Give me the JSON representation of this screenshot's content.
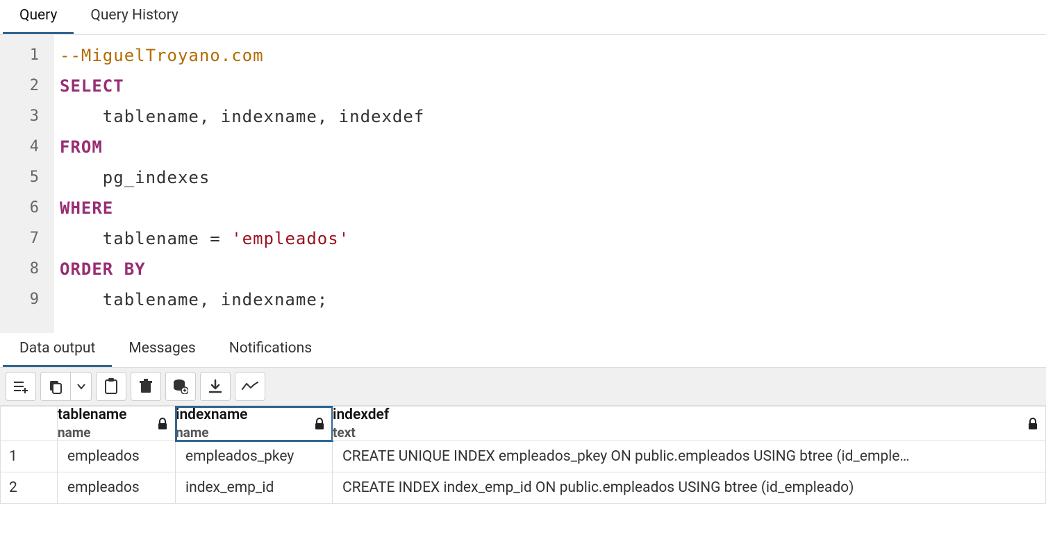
{
  "tabs": {
    "query": "Query",
    "history": "Query History"
  },
  "editor": {
    "lines": [
      "1",
      "2",
      "3",
      "4",
      "5",
      "6",
      "7",
      "8",
      "9"
    ],
    "code": {
      "l1": "--MiguelTroyano.com",
      "l2": "SELECT",
      "l3": "    tablename, indexname, indexdef",
      "l4": "FROM",
      "l5": "    pg_indexes",
      "l6": "WHERE",
      "l7a": "    tablename ",
      "l7op": "=",
      "l7b": " ",
      "l7str": "'empleados'",
      "l8": "ORDER BY",
      "l9": "    tablename, indexname;"
    }
  },
  "output_tabs": {
    "data": "Data output",
    "messages": "Messages",
    "notifications": "Notifications"
  },
  "toolbar_icons": {
    "add_row": "add-row-icon",
    "copy": "copy-icon",
    "copy_menu": "chevron-down-icon",
    "paste": "paste-icon",
    "delete": "trash-icon",
    "save_data": "save-data-icon",
    "download": "download-icon",
    "graph": "graph-icon"
  },
  "columns": [
    {
      "name": "tablename",
      "type": "name",
      "locked": true
    },
    {
      "name": "indexname",
      "type": "name",
      "locked": true,
      "selected": true
    },
    {
      "name": "indexdef",
      "type": "text",
      "locked": true
    }
  ],
  "rows": [
    {
      "n": "1",
      "tablename": "empleados",
      "indexname": "empleados_pkey",
      "indexdef": "CREATE UNIQUE INDEX empleados_pkey ON public.empleados USING btree (id_emple…"
    },
    {
      "n": "2",
      "tablename": "empleados",
      "indexname": "index_emp_id",
      "indexdef": "CREATE INDEX index_emp_id ON public.empleados USING btree (id_empleado)"
    }
  ]
}
